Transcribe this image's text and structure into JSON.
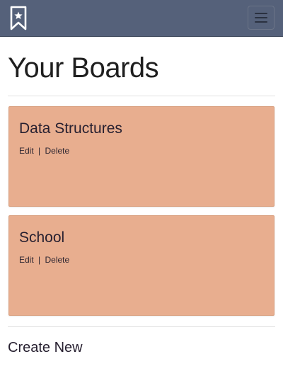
{
  "colors": {
    "navbar_bg": "#55617a",
    "brand_icon": "#ffffff",
    "card_bg": "#e8ae8f",
    "text_dark": "#272030"
  },
  "navbar": {
    "brand_icon": "bookmark-star-icon",
    "menu_icon": "hamburger-menu-icon"
  },
  "page": {
    "title": "Your Boards"
  },
  "boards": [
    {
      "title": "Data Structures",
      "edit_label": "Edit",
      "separator": "|",
      "delete_label": "Delete"
    },
    {
      "title": "School",
      "edit_label": "Edit",
      "separator": "|",
      "delete_label": "Delete"
    }
  ],
  "footer": {
    "create_label": "Create New"
  }
}
